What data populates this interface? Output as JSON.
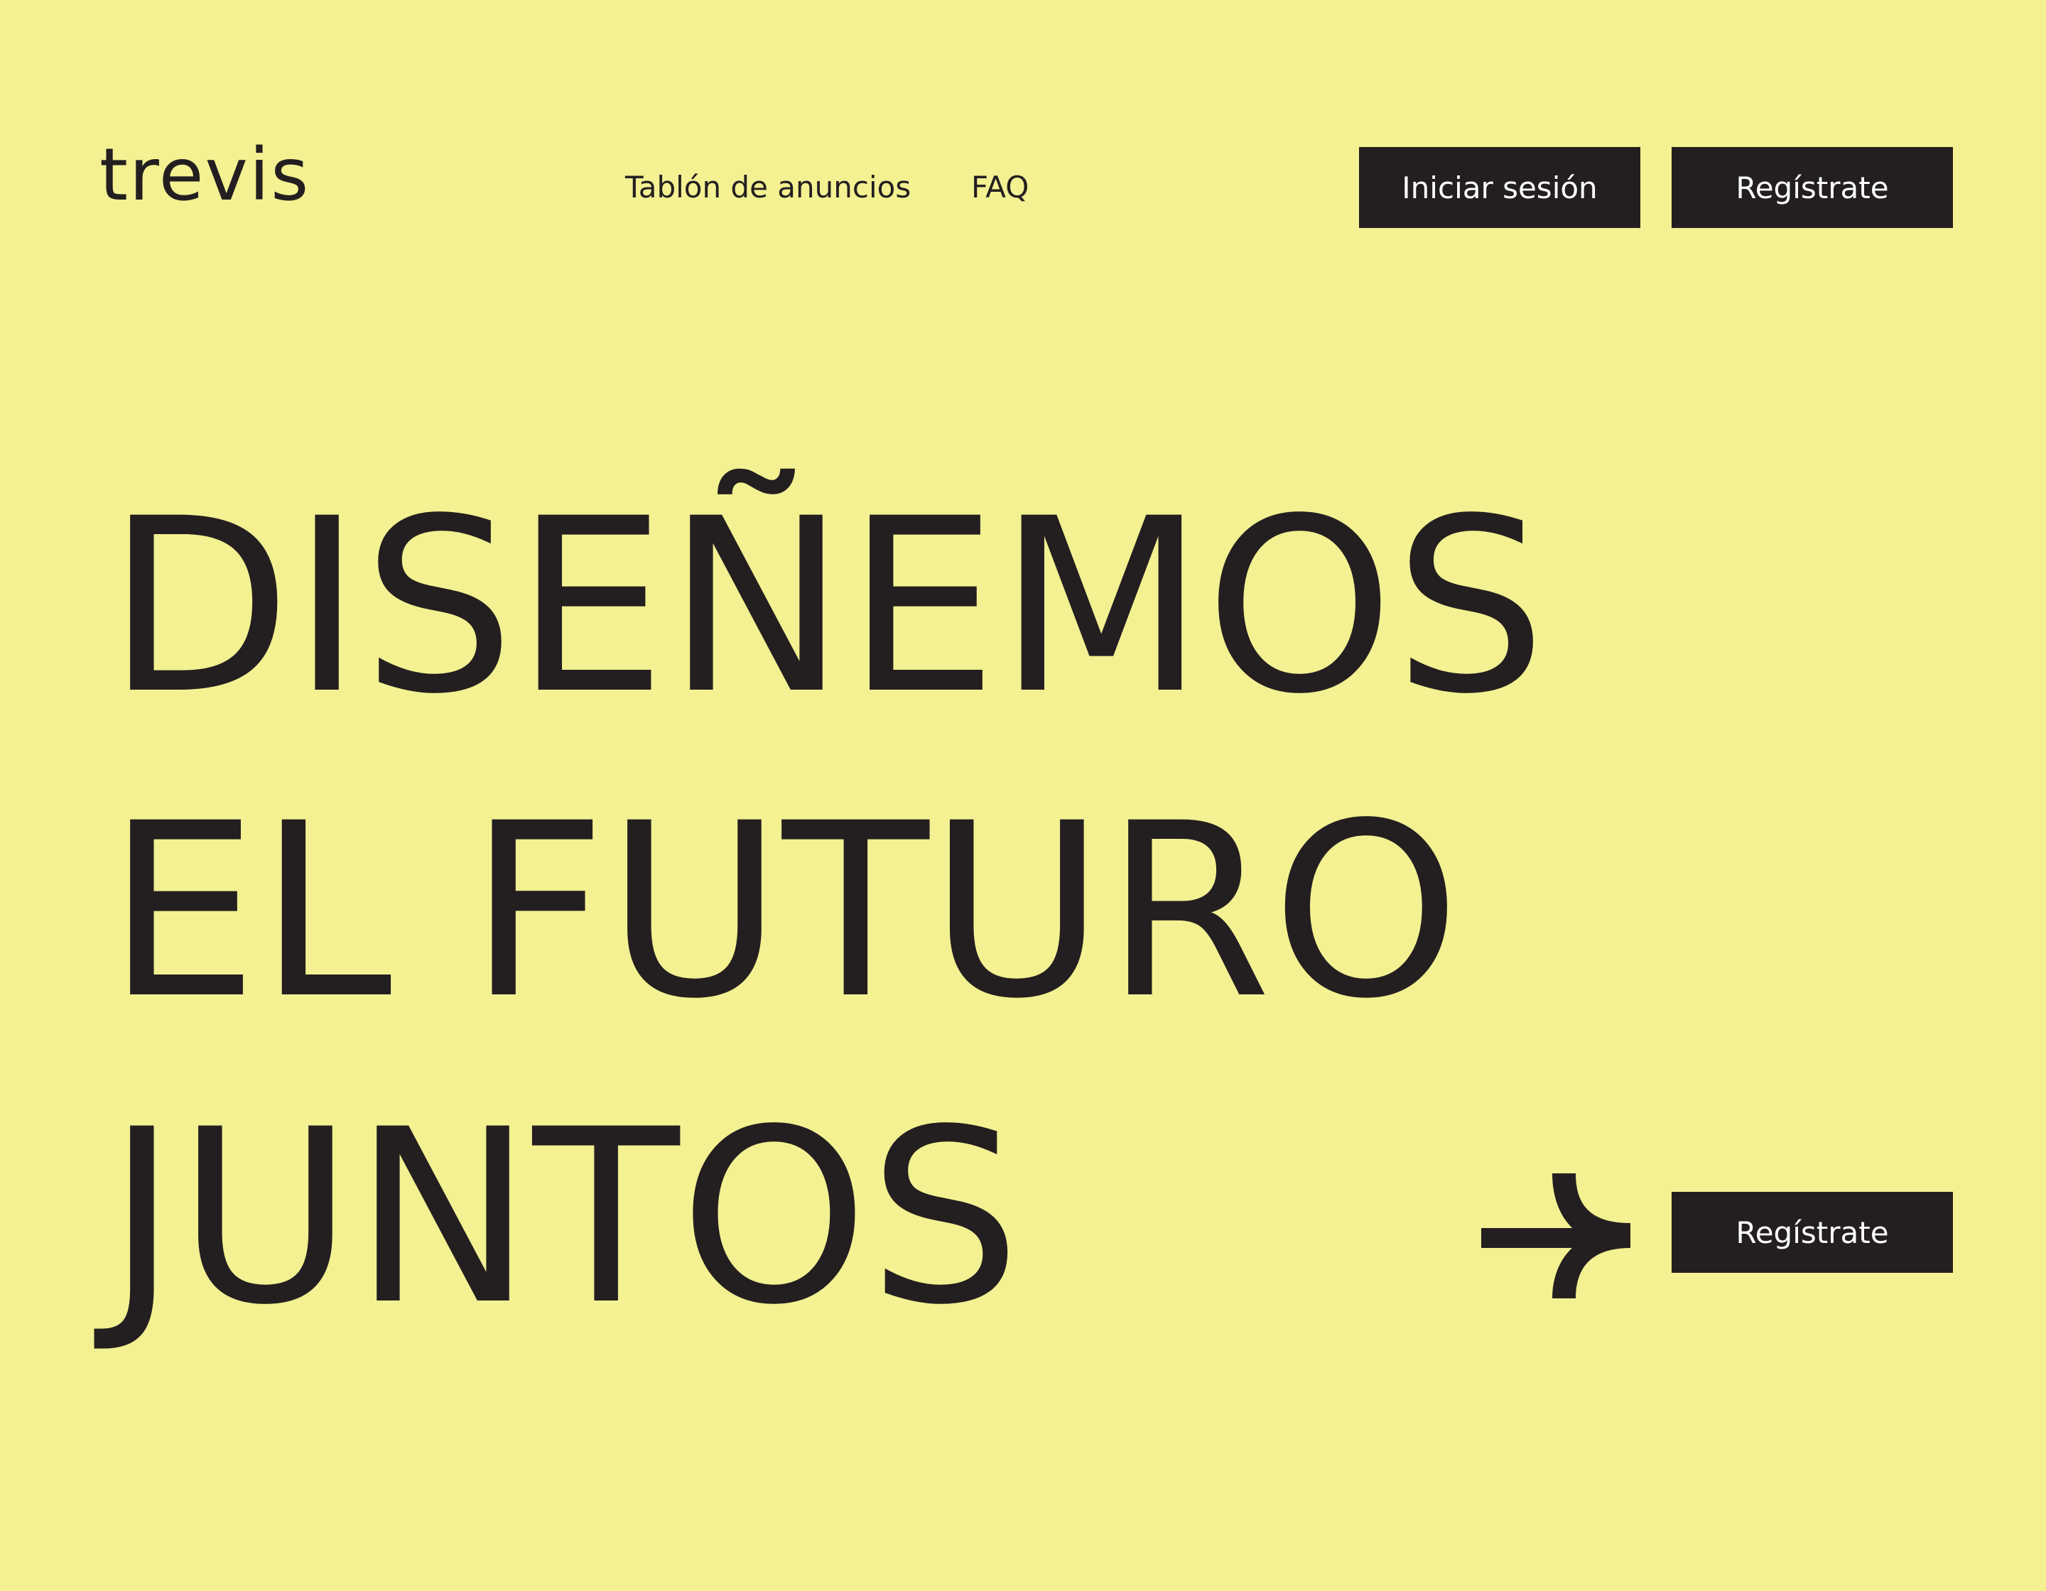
{
  "brand": {
    "logo_text": "trevis"
  },
  "nav": {
    "items": [
      {
        "label": "Tablón de anuncios"
      },
      {
        "label": "FAQ"
      }
    ]
  },
  "header_actions": {
    "login_label": "Iniciar sesión",
    "register_label": "Regístrate"
  },
  "hero": {
    "lines": [
      "DISEÑEMOS",
      "EL FUTURO",
      "JUNTOS"
    ],
    "cta_label": "Regístrate",
    "cta_icon": "arrow-right-icon"
  },
  "colors": {
    "background": "#f3f192",
    "text": "#231f20",
    "button_bg": "#231f20",
    "button_text": "#ffffff"
  }
}
